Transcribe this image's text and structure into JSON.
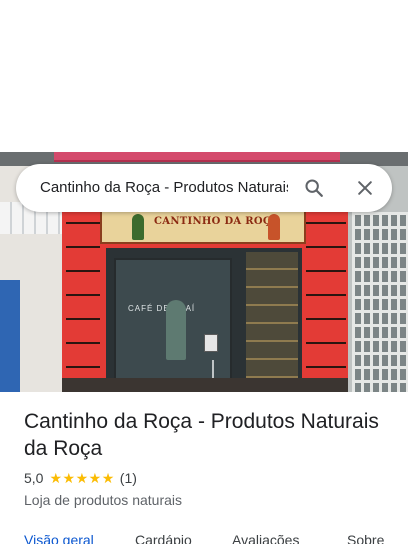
{
  "search": {
    "query": "Cantinho da Roça - Produtos Naturais da Roça"
  },
  "icons": {
    "search": "search-icon",
    "close": "close-icon",
    "star": "star-icon"
  },
  "photo": {
    "shop_sign": "CANTINHO DA ROÇA",
    "door_text": "CAFÉ DE AÇAÍ"
  },
  "place": {
    "title": "Cantinho da Roça - Produtos Naturais da Roça",
    "rating": "5,0",
    "stars": 5,
    "reviews": "(1)",
    "category": "Loja de produtos naturais"
  },
  "tabs": [
    {
      "label": "Visão geral",
      "active": true
    },
    {
      "label": "Cardápio",
      "active": false
    },
    {
      "label": "Avaliações",
      "active": false
    },
    {
      "label": "Sobre",
      "active": false
    }
  ],
  "colors": {
    "star": "#fbbc04",
    "active_tab": "#0b57d0",
    "text_primary": "#202124",
    "text_secondary": "#5f6368"
  }
}
